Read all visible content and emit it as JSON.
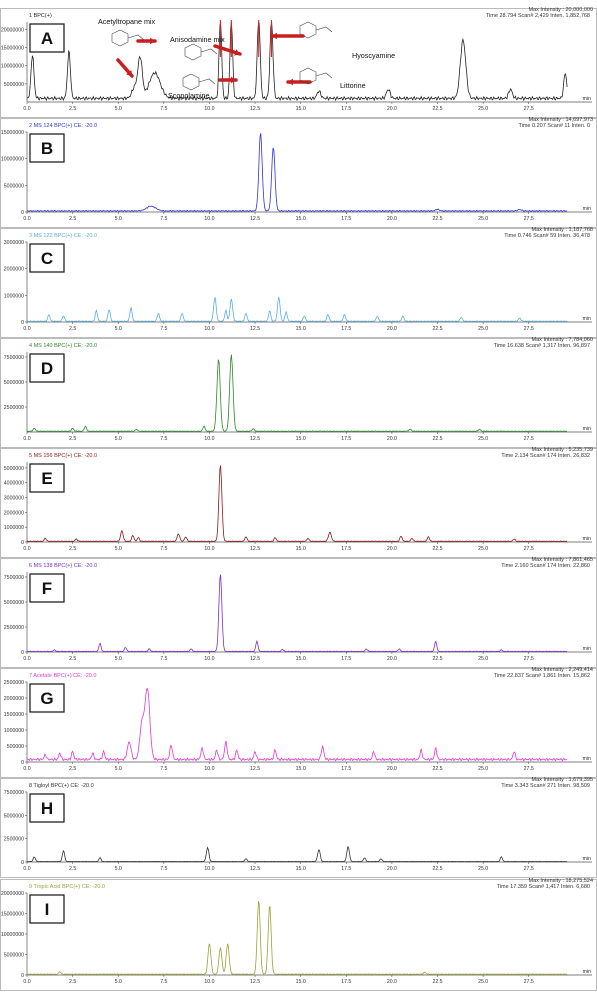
{
  "x_ticks": [
    "0.0",
    "2.5",
    "5.0",
    "7.5",
    "10.0",
    "12.5",
    "15.0",
    "17.5",
    "20.0",
    "22.5",
    "25.0",
    "27.5",
    "min"
  ],
  "panels": [
    {
      "letter": "A",
      "trace_label": "1 BPC(+)",
      "top_right": "Max Intensity : 20,000,000",
      "readout": "Time  28.794   Scan# 2,429   Inten.   1,852,768",
      "y_ticks": [
        "20000000",
        "15000000",
        "10000000",
        "5000000"
      ],
      "color": "#222222",
      "annotations": [
        "Acetyltropane mix",
        "Anisodamine mix",
        "Scopolamine",
        "Hyoscyamine",
        "Littorine"
      ],
      "chart_data": {
        "type": "line",
        "ylim": [
          0,
          22000000
        ],
        "baseline": 1000000,
        "peaks": [
          {
            "x": 0.3,
            "y": 12000000,
            "w": 0.08
          },
          {
            "x": 2.3,
            "y": 13000000,
            "w": 0.08
          },
          {
            "x": 5.9,
            "y": 3000000,
            "w": 0.15
          },
          {
            "x": 6.2,
            "y": 11000000,
            "w": 0.12
          },
          {
            "x": 7.0,
            "y": 7000000,
            "w": 0.3
          },
          {
            "x": 10.6,
            "y": 22000000,
            "w": 0.07
          },
          {
            "x": 11.2,
            "y": 22000000,
            "w": 0.07
          },
          {
            "x": 12.7,
            "y": 22000000,
            "w": 0.08
          },
          {
            "x": 13.4,
            "y": 22000000,
            "w": 0.08
          },
          {
            "x": 16.0,
            "y": 2000000,
            "w": 0.1
          },
          {
            "x": 19.8,
            "y": 2500000,
            "w": 0.1
          },
          {
            "x": 23.9,
            "y": 16000000,
            "w": 0.15
          },
          {
            "x": 26.5,
            "y": 2500000,
            "w": 0.1
          },
          {
            "x": 29.5,
            "y": 7000000,
            "w": 0.08
          }
        ]
      }
    },
    {
      "letter": "B",
      "trace_label": "2 MS 124 BPC(+) CE: -20.0",
      "top_right": "Max Intensity : 14,697,973",
      "readout": "Time  0.207   Scan#  11   Inten.   0",
      "y_ticks": [
        "15000000",
        "10000000",
        "5000000",
        "0"
      ],
      "color": "#2f33d6",
      "chart_data": {
        "type": "line",
        "ylim": [
          0,
          15000000
        ],
        "baseline": 200000,
        "peaks": [
          {
            "x": 6.8,
            "y": 900000,
            "w": 0.25
          },
          {
            "x": 12.8,
            "y": 14700000,
            "w": 0.09
          },
          {
            "x": 13.5,
            "y": 12000000,
            "w": 0.09
          },
          {
            "x": 22.5,
            "y": 300000,
            "w": 0.1
          },
          {
            "x": 27.0,
            "y": 250000,
            "w": 0.1
          }
        ]
      }
    },
    {
      "letter": "C",
      "trace_label": "3 MS 122 BPC(+) CE: -20.0",
      "top_right": "Max Intensity : 1,187,768",
      "readout": "Time  0.746   Scan#  59   Inten.   36,478",
      "y_ticks": [
        "3000000",
        "2000000",
        "1000000",
        "0"
      ],
      "color": "#5aaee6",
      "chart_data": {
        "type": "line",
        "ylim": [
          0,
          3000000
        ],
        "baseline": 30000,
        "peaks": [
          {
            "x": 1.2,
            "y": 250000,
            "w": 0.06
          },
          {
            "x": 2.0,
            "y": 200000,
            "w": 0.06
          },
          {
            "x": 3.8,
            "y": 400000,
            "w": 0.06
          },
          {
            "x": 4.5,
            "y": 450000,
            "w": 0.06
          },
          {
            "x": 5.7,
            "y": 500000,
            "w": 0.06
          },
          {
            "x": 7.2,
            "y": 300000,
            "w": 0.06
          },
          {
            "x": 8.5,
            "y": 300000,
            "w": 0.06
          },
          {
            "x": 10.3,
            "y": 900000,
            "w": 0.07
          },
          {
            "x": 10.9,
            "y": 400000,
            "w": 0.06
          },
          {
            "x": 11.2,
            "y": 850000,
            "w": 0.07
          },
          {
            "x": 12.0,
            "y": 300000,
            "w": 0.06
          },
          {
            "x": 13.3,
            "y": 400000,
            "w": 0.06
          },
          {
            "x": 13.8,
            "y": 900000,
            "w": 0.07
          },
          {
            "x": 14.2,
            "y": 350000,
            "w": 0.06
          },
          {
            "x": 15.2,
            "y": 200000,
            "w": 0.06
          },
          {
            "x": 16.5,
            "y": 250000,
            "w": 0.06
          },
          {
            "x": 17.4,
            "y": 250000,
            "w": 0.06
          },
          {
            "x": 19.2,
            "y": 200000,
            "w": 0.06
          },
          {
            "x": 20.6,
            "y": 200000,
            "w": 0.06
          },
          {
            "x": 23.8,
            "y": 150000,
            "w": 0.06
          },
          {
            "x": 27.0,
            "y": 120000,
            "w": 0.06
          }
        ]
      }
    },
    {
      "letter": "D",
      "trace_label": "4 MS 140 BPC(+) CE: -20.0",
      "top_right": "Max Intensity : 7,784,060",
      "readout": "Time  16.638   Scan# 1,317   Inten.   96,897",
      "y_ticks": [
        "7500000",
        "5000000",
        "2500000"
      ],
      "color": "#2a8a2a",
      "chart_data": {
        "type": "line",
        "ylim": [
          0,
          8000000
        ],
        "baseline": 80000,
        "peaks": [
          {
            "x": 0.4,
            "y": 300000,
            "w": 0.06
          },
          {
            "x": 2.5,
            "y": 300000,
            "w": 0.06
          },
          {
            "x": 3.2,
            "y": 500000,
            "w": 0.06
          },
          {
            "x": 6.0,
            "y": 200000,
            "w": 0.06
          },
          {
            "x": 9.7,
            "y": 500000,
            "w": 0.06
          },
          {
            "x": 10.5,
            "y": 7200000,
            "w": 0.09
          },
          {
            "x": 11.2,
            "y": 7700000,
            "w": 0.09
          },
          {
            "x": 12.4,
            "y": 250000,
            "w": 0.06
          },
          {
            "x": 21.0,
            "y": 200000,
            "w": 0.06
          },
          {
            "x": 24.8,
            "y": 200000,
            "w": 0.06
          }
        ]
      }
    },
    {
      "letter": "E",
      "trace_label": "5 MS 156 BPC(+) CE: -20.0",
      "top_right": "Max Intensity : 5,235,739",
      "readout": "Time  2.134   Scan#  174   Inten.   26,832",
      "y_ticks": [
        "5000000",
        "4000000",
        "3000000",
        "2000000",
        "1000000",
        "0"
      ],
      "color": "#8b1a1a",
      "chart_data": {
        "type": "line",
        "ylim": [
          0,
          5400000
        ],
        "baseline": 50000,
        "peaks": [
          {
            "x": 1.0,
            "y": 200000,
            "w": 0.06
          },
          {
            "x": 2.7,
            "y": 150000,
            "w": 0.06
          },
          {
            "x": 5.2,
            "y": 700000,
            "w": 0.07
          },
          {
            "x": 5.8,
            "y": 400000,
            "w": 0.06
          },
          {
            "x": 6.1,
            "y": 250000,
            "w": 0.06
          },
          {
            "x": 8.3,
            "y": 500000,
            "w": 0.07
          },
          {
            "x": 8.7,
            "y": 300000,
            "w": 0.06
          },
          {
            "x": 10.6,
            "y": 5200000,
            "w": 0.08
          },
          {
            "x": 12.0,
            "y": 300000,
            "w": 0.06
          },
          {
            "x": 13.6,
            "y": 250000,
            "w": 0.06
          },
          {
            "x": 15.4,
            "y": 200000,
            "w": 0.06
          },
          {
            "x": 16.6,
            "y": 600000,
            "w": 0.08
          },
          {
            "x": 20.5,
            "y": 350000,
            "w": 0.06
          },
          {
            "x": 21.1,
            "y": 200000,
            "w": 0.06
          },
          {
            "x": 22.0,
            "y": 300000,
            "w": 0.06
          },
          {
            "x": 26.7,
            "y": 150000,
            "w": 0.06
          }
        ]
      }
    },
    {
      "letter": "F",
      "trace_label": "6 MS 138 BPC(+) CE: -20.0",
      "top_right": "Max Intensity : 7,861,465",
      "readout": "Time  2.160   Scan#  174   Inten.   22,860",
      "y_ticks": [
        "7500000",
        "5000000",
        "2500000",
        "0"
      ],
      "color": "#7b2fd0",
      "chart_data": {
        "type": "line",
        "ylim": [
          0,
          8000000
        ],
        "baseline": 60000,
        "peaks": [
          {
            "x": 1.5,
            "y": 150000,
            "w": 0.06
          },
          {
            "x": 4.0,
            "y": 800000,
            "w": 0.06
          },
          {
            "x": 5.4,
            "y": 400000,
            "w": 0.06
          },
          {
            "x": 6.7,
            "y": 250000,
            "w": 0.06
          },
          {
            "x": 9.0,
            "y": 250000,
            "w": 0.06
          },
          {
            "x": 10.6,
            "y": 7800000,
            "w": 0.08
          },
          {
            "x": 12.6,
            "y": 1000000,
            "w": 0.06
          },
          {
            "x": 14.0,
            "y": 200000,
            "w": 0.06
          },
          {
            "x": 18.6,
            "y": 250000,
            "w": 0.06
          },
          {
            "x": 20.4,
            "y": 250000,
            "w": 0.06
          },
          {
            "x": 22.4,
            "y": 1000000,
            "w": 0.06
          },
          {
            "x": 26.0,
            "y": 150000,
            "w": 0.06
          }
        ]
      }
    },
    {
      "letter": "G",
      "trace_label": "7 Acetate BPC(+) CE: -20.0",
      "top_right": "Max Intensity : 2,249,414",
      "readout": "Time  22.837   Scan# 1,861   Inten.   15,862",
      "y_ticks": [
        "2500000",
        "2000000",
        "1500000",
        "1000000",
        "500000",
        "0"
      ],
      "color": "#e03ad0",
      "chart_data": {
        "type": "line",
        "ylim": [
          0,
          2500000
        ],
        "baseline": 80000,
        "peaks": [
          {
            "x": 1.0,
            "y": 150000,
            "w": 0.06
          },
          {
            "x": 1.8,
            "y": 200000,
            "w": 0.06
          },
          {
            "x": 2.5,
            "y": 250000,
            "w": 0.06
          },
          {
            "x": 3.6,
            "y": 200000,
            "w": 0.06
          },
          {
            "x": 4.2,
            "y": 250000,
            "w": 0.06
          },
          {
            "x": 5.6,
            "y": 550000,
            "w": 0.1
          },
          {
            "x": 6.3,
            "y": 1100000,
            "w": 0.12
          },
          {
            "x": 6.6,
            "y": 2200000,
            "w": 0.13
          },
          {
            "x": 7.9,
            "y": 450000,
            "w": 0.07
          },
          {
            "x": 9.6,
            "y": 350000,
            "w": 0.07
          },
          {
            "x": 10.4,
            "y": 300000,
            "w": 0.06
          },
          {
            "x": 10.9,
            "y": 550000,
            "w": 0.07
          },
          {
            "x": 11.5,
            "y": 300000,
            "w": 0.06
          },
          {
            "x": 12.5,
            "y": 250000,
            "w": 0.06
          },
          {
            "x": 13.6,
            "y": 300000,
            "w": 0.06
          },
          {
            "x": 16.2,
            "y": 400000,
            "w": 0.07
          },
          {
            "x": 19.0,
            "y": 250000,
            "w": 0.06
          },
          {
            "x": 21.6,
            "y": 300000,
            "w": 0.06
          },
          {
            "x": 22.4,
            "y": 350000,
            "w": 0.06
          },
          {
            "x": 26.7,
            "y": 250000,
            "w": 0.06
          }
        ]
      }
    },
    {
      "letter": "H",
      "trace_label": "8 Tigloyl BPC(+) CE: -20.0",
      "top_right": "Max Intensity : 1,679,395",
      "readout": "Time  3.343   Scan#  271   Inten.   98,509",
      "y_ticks": [
        "7500000",
        "5000000",
        "2500000",
        "0"
      ],
      "color": "#333333",
      "chart_data": {
        "type": "line",
        "ylim": [
          0,
          7500000
        ],
        "baseline": 50000,
        "peaks": [
          {
            "x": 0.4,
            "y": 500000,
            "w": 0.06
          },
          {
            "x": 2.0,
            "y": 1200000,
            "w": 0.06
          },
          {
            "x": 4.0,
            "y": 400000,
            "w": 0.06
          },
          {
            "x": 9.9,
            "y": 1500000,
            "w": 0.07
          },
          {
            "x": 12.0,
            "y": 300000,
            "w": 0.06
          },
          {
            "x": 16.0,
            "y": 1300000,
            "w": 0.07
          },
          {
            "x": 17.6,
            "y": 1600000,
            "w": 0.07
          },
          {
            "x": 18.5,
            "y": 400000,
            "w": 0.06
          },
          {
            "x": 19.4,
            "y": 300000,
            "w": 0.06
          },
          {
            "x": 26.0,
            "y": 500000,
            "w": 0.06
          }
        ]
      }
    },
    {
      "letter": "I",
      "trace_label": "9 Tropic Acid BPC(+) CE: -20.0",
      "top_right": "Max Intensity : 18,275,524",
      "readout": "Time  17.359   Scan# 1,417   Inten.   6,680",
      "y_ticks": [
        "20000000",
        "15000000",
        "10000000",
        "5000000",
        "0"
      ],
      "color": "#9aa23a",
      "chart_data": {
        "type": "line",
        "ylim": [
          0,
          20000000
        ],
        "baseline": 200000,
        "peaks": [
          {
            "x": 1.8,
            "y": 600000,
            "w": 0.06
          },
          {
            "x": 10.0,
            "y": 7500000,
            "w": 0.08
          },
          {
            "x": 10.6,
            "y": 6500000,
            "w": 0.08
          },
          {
            "x": 11.0,
            "y": 7500000,
            "w": 0.08
          },
          {
            "x": 12.7,
            "y": 18200000,
            "w": 0.08
          },
          {
            "x": 13.3,
            "y": 17000000,
            "w": 0.08
          },
          {
            "x": 21.8,
            "y": 500000,
            "w": 0.06
          }
        ]
      }
    }
  ]
}
